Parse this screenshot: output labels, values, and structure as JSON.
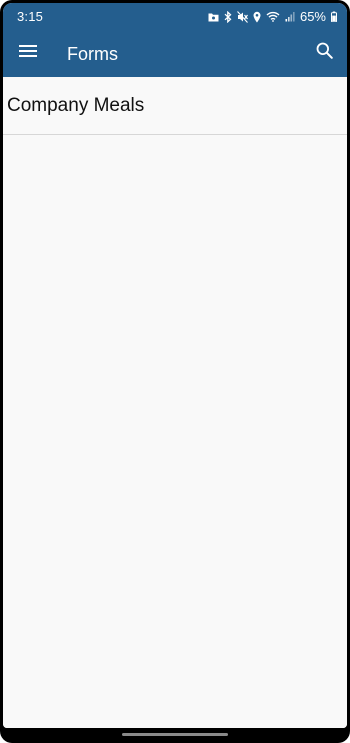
{
  "status_bar": {
    "time": "3:15",
    "battery_percent": "65%",
    "icons": [
      "folder-icon",
      "bluetooth-icon",
      "mute-icon",
      "location-icon",
      "wifi-icon",
      "signal-icon",
      "battery-icon"
    ]
  },
  "app_bar": {
    "title": "Forms",
    "menu_icon": "hamburger-menu-icon",
    "search_icon": "search-icon",
    "background_color": "#245e8e"
  },
  "forms": [
    {
      "label": "Company Meals"
    }
  ]
}
